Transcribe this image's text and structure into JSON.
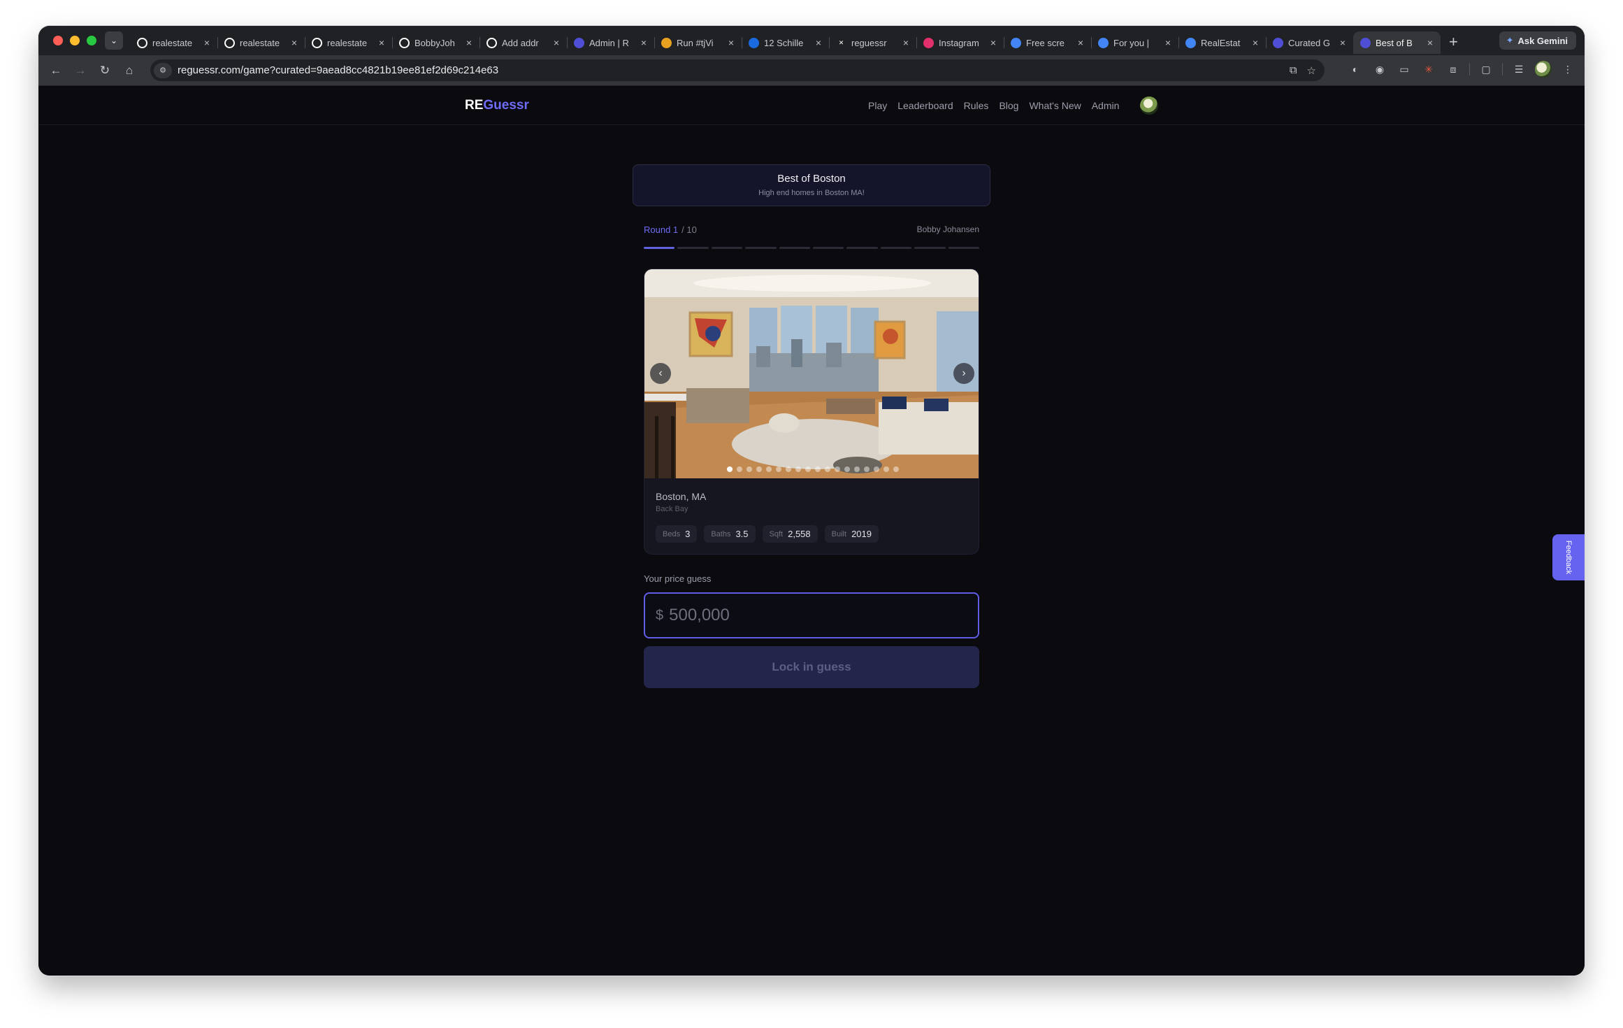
{
  "browser": {
    "tabs": [
      {
        "title": "realestate",
        "icon": "github-icon",
        "color": "#ffffff"
      },
      {
        "title": "realestate",
        "icon": "github-icon",
        "color": "#ffffff"
      },
      {
        "title": "realestate",
        "icon": "github-icon",
        "color": "#ffffff"
      },
      {
        "title": "BobbyJoh",
        "icon": "github-icon",
        "color": "#ffffff"
      },
      {
        "title": "Add addr",
        "icon": "github-icon",
        "color": "#ffffff"
      },
      {
        "title": "Admin | R",
        "icon": "reguessr-icon",
        "color": "#4f4fd6"
      },
      {
        "title": "Run #tjVi",
        "icon": "run-icon",
        "color": "#e8a020"
      },
      {
        "title": "12 Schille",
        "icon": "zillow-icon",
        "color": "#1a6ae0"
      },
      {
        "title": "reguessr",
        "icon": "x-icon",
        "color": "#ffffff"
      },
      {
        "title": "Instagram",
        "icon": "instagram-icon",
        "color": "#e1306c"
      },
      {
        "title": "Free scre",
        "icon": "chrome-web-store-icon",
        "color": "#4285f4"
      },
      {
        "title": "For you |",
        "icon": "chrome-web-store-icon",
        "color": "#4285f4"
      },
      {
        "title": "RealEstat",
        "icon": "chrome-web-store-icon",
        "color": "#4285f4"
      },
      {
        "title": "Curated G",
        "icon": "reguessr-icon",
        "color": "#4f4fd6"
      },
      {
        "title": "Best of B",
        "icon": "reguessr-icon",
        "color": "#4f4fd6",
        "active": true
      }
    ],
    "gemini_label": "Ask Gemini",
    "url": "reguessr.com/game?curated=9aead8cc4821b19ee81ef2d69c214e63"
  },
  "nav": {
    "brand_re": "RE",
    "brand_guessr": "Guessr",
    "links": [
      "Play",
      "Leaderboard",
      "Rules",
      "Blog",
      "What's New",
      "Admin"
    ]
  },
  "banner": {
    "title": "Best of Boston",
    "subtitle": "High end homes in Boston MA!"
  },
  "round": {
    "current_label": "Round 1",
    "total_label": "/ 10",
    "current": 1,
    "total": 10,
    "player": "Bobby Johansen"
  },
  "listing": {
    "photo_count": 18,
    "photo_index": 1,
    "city": "Boston, MA",
    "neighborhood": "Back Bay",
    "stats": [
      {
        "key": "Beds",
        "value": "3"
      },
      {
        "key": "Baths",
        "value": "3.5"
      },
      {
        "key": "Sqft",
        "value": "2,558"
      },
      {
        "key": "Built",
        "value": "2019"
      }
    ]
  },
  "guess": {
    "label": "Your price guess",
    "currency": "$",
    "value": "",
    "placeholder": "500,000",
    "button": "Lock in guess"
  },
  "feedback_label": "Feedback",
  "colors": {
    "accent": "#6f6cf6",
    "background": "#0a0a0f",
    "card": "#15161f",
    "button_disabled": "#24254a"
  }
}
